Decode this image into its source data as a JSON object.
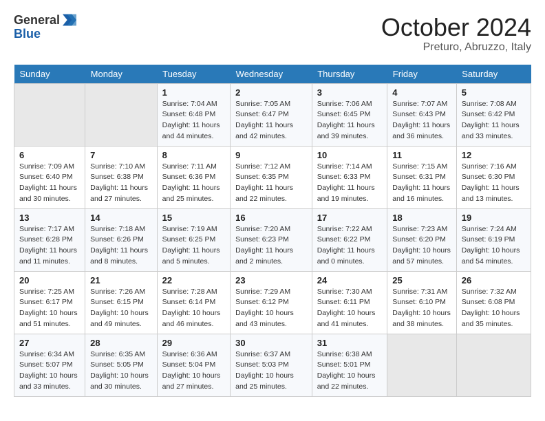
{
  "header": {
    "logo_general": "General",
    "logo_blue": "Blue",
    "title": "October 2024",
    "location": "Preturo, Abruzzo, Italy"
  },
  "weekdays": [
    "Sunday",
    "Monday",
    "Tuesday",
    "Wednesday",
    "Thursday",
    "Friday",
    "Saturday"
  ],
  "weeks": [
    [
      {
        "day": "",
        "empty": true
      },
      {
        "day": "",
        "empty": true
      },
      {
        "day": "1",
        "sunrise": "7:04 AM",
        "sunset": "6:48 PM",
        "daylight": "11 hours and 44 minutes."
      },
      {
        "day": "2",
        "sunrise": "7:05 AM",
        "sunset": "6:47 PM",
        "daylight": "11 hours and 42 minutes."
      },
      {
        "day": "3",
        "sunrise": "7:06 AM",
        "sunset": "6:45 PM",
        "daylight": "11 hours and 39 minutes."
      },
      {
        "day": "4",
        "sunrise": "7:07 AM",
        "sunset": "6:43 PM",
        "daylight": "11 hours and 36 minutes."
      },
      {
        "day": "5",
        "sunrise": "7:08 AM",
        "sunset": "6:42 PM",
        "daylight": "11 hours and 33 minutes."
      }
    ],
    [
      {
        "day": "6",
        "sunrise": "7:09 AM",
        "sunset": "6:40 PM",
        "daylight": "11 hours and 30 minutes."
      },
      {
        "day": "7",
        "sunrise": "7:10 AM",
        "sunset": "6:38 PM",
        "daylight": "11 hours and 27 minutes."
      },
      {
        "day": "8",
        "sunrise": "7:11 AM",
        "sunset": "6:36 PM",
        "daylight": "11 hours and 25 minutes."
      },
      {
        "day": "9",
        "sunrise": "7:12 AM",
        "sunset": "6:35 PM",
        "daylight": "11 hours and 22 minutes."
      },
      {
        "day": "10",
        "sunrise": "7:14 AM",
        "sunset": "6:33 PM",
        "daylight": "11 hours and 19 minutes."
      },
      {
        "day": "11",
        "sunrise": "7:15 AM",
        "sunset": "6:31 PM",
        "daylight": "11 hours and 16 minutes."
      },
      {
        "day": "12",
        "sunrise": "7:16 AM",
        "sunset": "6:30 PM",
        "daylight": "11 hours and 13 minutes."
      }
    ],
    [
      {
        "day": "13",
        "sunrise": "7:17 AM",
        "sunset": "6:28 PM",
        "daylight": "11 hours and 11 minutes."
      },
      {
        "day": "14",
        "sunrise": "7:18 AM",
        "sunset": "6:26 PM",
        "daylight": "11 hours and 8 minutes."
      },
      {
        "day": "15",
        "sunrise": "7:19 AM",
        "sunset": "6:25 PM",
        "daylight": "11 hours and 5 minutes."
      },
      {
        "day": "16",
        "sunrise": "7:20 AM",
        "sunset": "6:23 PM",
        "daylight": "11 hours and 2 minutes."
      },
      {
        "day": "17",
        "sunrise": "7:22 AM",
        "sunset": "6:22 PM",
        "daylight": "11 hours and 0 minutes."
      },
      {
        "day": "18",
        "sunrise": "7:23 AM",
        "sunset": "6:20 PM",
        "daylight": "10 hours and 57 minutes."
      },
      {
        "day": "19",
        "sunrise": "7:24 AM",
        "sunset": "6:19 PM",
        "daylight": "10 hours and 54 minutes."
      }
    ],
    [
      {
        "day": "20",
        "sunrise": "7:25 AM",
        "sunset": "6:17 PM",
        "daylight": "10 hours and 51 minutes."
      },
      {
        "day": "21",
        "sunrise": "7:26 AM",
        "sunset": "6:15 PM",
        "daylight": "10 hours and 49 minutes."
      },
      {
        "day": "22",
        "sunrise": "7:28 AM",
        "sunset": "6:14 PM",
        "daylight": "10 hours and 46 minutes."
      },
      {
        "day": "23",
        "sunrise": "7:29 AM",
        "sunset": "6:12 PM",
        "daylight": "10 hours and 43 minutes."
      },
      {
        "day": "24",
        "sunrise": "7:30 AM",
        "sunset": "6:11 PM",
        "daylight": "10 hours and 41 minutes."
      },
      {
        "day": "25",
        "sunrise": "7:31 AM",
        "sunset": "6:10 PM",
        "daylight": "10 hours and 38 minutes."
      },
      {
        "day": "26",
        "sunrise": "7:32 AM",
        "sunset": "6:08 PM",
        "daylight": "10 hours and 35 minutes."
      }
    ],
    [
      {
        "day": "27",
        "sunrise": "6:34 AM",
        "sunset": "5:07 PM",
        "daylight": "10 hours and 33 minutes."
      },
      {
        "day": "28",
        "sunrise": "6:35 AM",
        "sunset": "5:05 PM",
        "daylight": "10 hours and 30 minutes."
      },
      {
        "day": "29",
        "sunrise": "6:36 AM",
        "sunset": "5:04 PM",
        "daylight": "10 hours and 27 minutes."
      },
      {
        "day": "30",
        "sunrise": "6:37 AM",
        "sunset": "5:03 PM",
        "daylight": "10 hours and 25 minutes."
      },
      {
        "day": "31",
        "sunrise": "6:38 AM",
        "sunset": "5:01 PM",
        "daylight": "10 hours and 22 minutes."
      },
      {
        "day": "",
        "empty": true
      },
      {
        "day": "",
        "empty": true
      }
    ]
  ]
}
